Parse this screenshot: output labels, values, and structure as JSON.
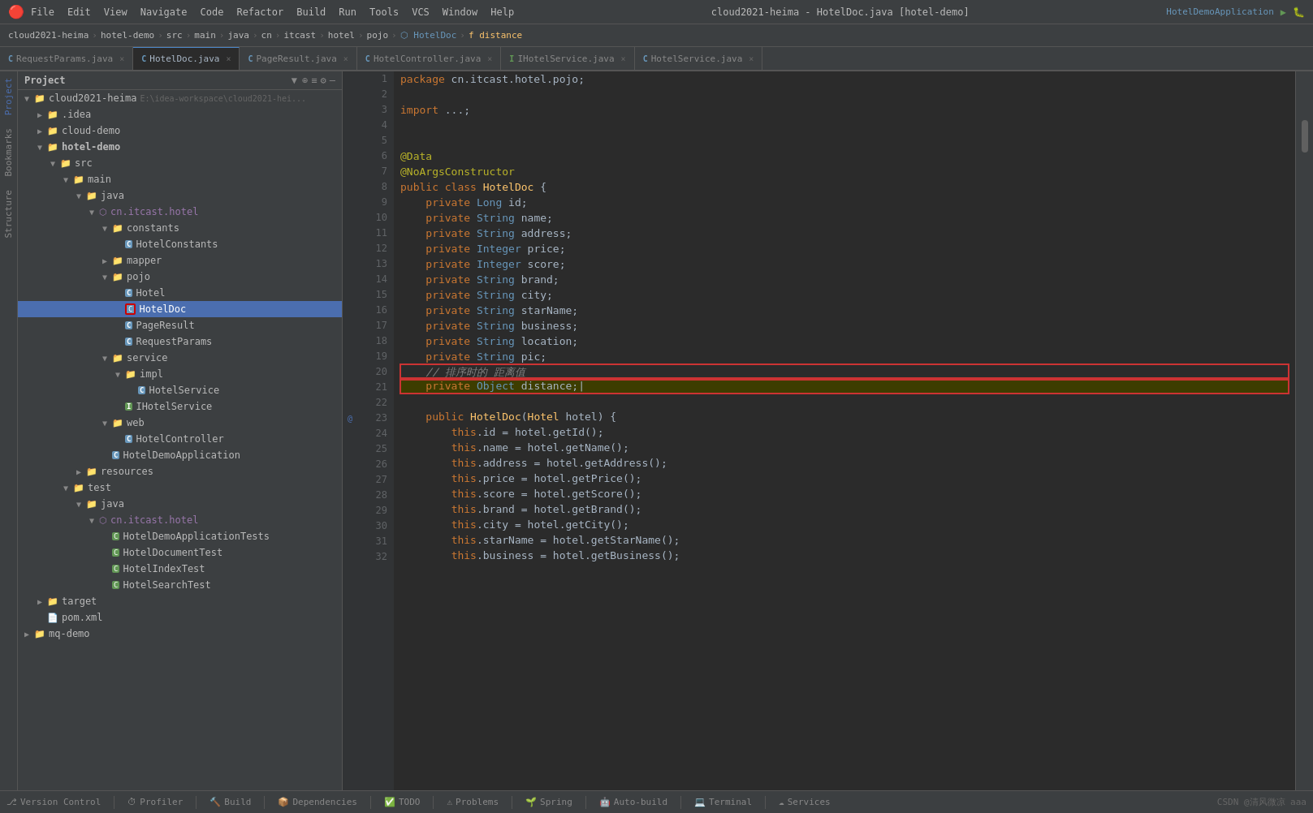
{
  "titleBar": {
    "logo": "🔴",
    "menus": [
      "File",
      "Edit",
      "View",
      "Navigate",
      "Code",
      "Refactor",
      "Build",
      "Run",
      "Tools",
      "VCS",
      "Window",
      "Help"
    ],
    "title": "cloud2021-heima - HotelDoc.java [hotel-demo]",
    "runConfig": "HotelDemoApplication"
  },
  "breadcrumb": {
    "items": [
      "cloud2021-heima",
      "hotel-demo",
      "src",
      "main",
      "java",
      "cn",
      "itcast",
      "hotel",
      "pojo",
      "HotelDoc",
      "distance"
    ]
  },
  "tabs": [
    {
      "label": "RequestParams.java",
      "type": "c",
      "active": false,
      "closable": true
    },
    {
      "label": "HotelDoc.java",
      "type": "c",
      "active": true,
      "closable": true
    },
    {
      "label": "PageResult.java",
      "type": "c",
      "active": false,
      "closable": true
    },
    {
      "label": "HotelController.java",
      "type": "c",
      "active": false,
      "closable": true
    },
    {
      "label": "IHotelService.java",
      "type": "i",
      "active": false,
      "closable": true
    },
    {
      "label": "HotelService.java",
      "type": "c",
      "active": false,
      "closable": true
    }
  ],
  "sidebar": {
    "title": "Project",
    "tree": [
      {
        "indent": 0,
        "arrow": "▼",
        "icon": "folder",
        "label": "cloud2021-heima",
        "extra": "E:\\idea-workspace\\cloud2021-hei..."
      },
      {
        "indent": 1,
        "arrow": "▶",
        "icon": "folder",
        "label": ".idea"
      },
      {
        "indent": 1,
        "arrow": "▶",
        "icon": "folder",
        "label": "cloud-demo"
      },
      {
        "indent": 1,
        "arrow": "▼",
        "icon": "folder",
        "label": "hotel-demo",
        "bold": true
      },
      {
        "indent": 2,
        "arrow": "▼",
        "icon": "folder",
        "label": "src"
      },
      {
        "indent": 3,
        "arrow": "▼",
        "icon": "folder",
        "label": "main"
      },
      {
        "indent": 4,
        "arrow": "▼",
        "icon": "folder",
        "label": "java"
      },
      {
        "indent": 5,
        "arrow": "▼",
        "icon": "package",
        "label": "cn.itcast.hotel"
      },
      {
        "indent": 6,
        "arrow": "▼",
        "icon": "folder",
        "label": "constants"
      },
      {
        "indent": 7,
        "arrow": "",
        "icon": "c",
        "label": "HotelConstants"
      },
      {
        "indent": 6,
        "arrow": "▶",
        "icon": "folder",
        "label": "mapper"
      },
      {
        "indent": 6,
        "arrow": "▼",
        "icon": "folder",
        "label": "pojo"
      },
      {
        "indent": 7,
        "arrow": "",
        "icon": "c",
        "label": "Hotel"
      },
      {
        "indent": 7,
        "arrow": "",
        "icon": "c",
        "label": "HotelDoc",
        "selected": true
      },
      {
        "indent": 7,
        "arrow": "",
        "icon": "c",
        "label": "PageResult"
      },
      {
        "indent": 7,
        "arrow": "",
        "icon": "c",
        "label": "RequestParams"
      },
      {
        "indent": 6,
        "arrow": "▼",
        "icon": "folder",
        "label": "service"
      },
      {
        "indent": 7,
        "arrow": "▼",
        "icon": "folder",
        "label": "impl"
      },
      {
        "indent": 8,
        "arrow": "",
        "icon": "c",
        "label": "HotelService"
      },
      {
        "indent": 7,
        "arrow": "",
        "icon": "i",
        "label": "IHotelService"
      },
      {
        "indent": 6,
        "arrow": "▼",
        "icon": "folder",
        "label": "web"
      },
      {
        "indent": 7,
        "arrow": "",
        "icon": "c",
        "label": "HotelController"
      },
      {
        "indent": 6,
        "arrow": "",
        "icon": "c",
        "label": "HotelDemoApplication"
      },
      {
        "indent": 5,
        "arrow": "▶",
        "icon": "folder",
        "label": "resources"
      },
      {
        "indent": 3,
        "arrow": "▼",
        "icon": "folder",
        "label": "test"
      },
      {
        "indent": 4,
        "arrow": "▼",
        "icon": "folder",
        "label": "java"
      },
      {
        "indent": 5,
        "arrow": "▼",
        "icon": "package",
        "label": "cn.itcast.hotel"
      },
      {
        "indent": 6,
        "arrow": "",
        "icon": "ct",
        "label": "HotelDemoApplicationTests"
      },
      {
        "indent": 6,
        "arrow": "",
        "icon": "ct",
        "label": "HotelDocumentTest"
      },
      {
        "indent": 6,
        "arrow": "",
        "icon": "ct",
        "label": "HotelIndexTest"
      },
      {
        "indent": 6,
        "arrow": "",
        "icon": "ct",
        "label": "HotelSearchTest"
      },
      {
        "indent": 1,
        "arrow": "▶",
        "icon": "folder",
        "label": "target"
      },
      {
        "indent": 1,
        "arrow": "",
        "icon": "xml",
        "label": "pom.xml"
      },
      {
        "indent": 0,
        "arrow": "▶",
        "icon": "folder",
        "label": "mq-demo"
      }
    ]
  },
  "code": {
    "lines": [
      {
        "num": 1,
        "content": "package cn.itcast.hotel.pojo;",
        "tokens": [
          {
            "t": "kw",
            "v": "package"
          },
          {
            "t": "plain",
            "v": " cn.itcast.hotel.pojo;"
          }
        ]
      },
      {
        "num": 2,
        "content": "",
        "tokens": []
      },
      {
        "num": 3,
        "content": "import ...;",
        "tokens": [
          {
            "t": "kw",
            "v": "import"
          },
          {
            "t": "plain",
            "v": " ...;"
          }
        ]
      },
      {
        "num": 4,
        "content": "",
        "tokens": []
      },
      {
        "num": 5,
        "content": "",
        "tokens": []
      },
      {
        "num": 6,
        "content": "@Data",
        "tokens": [
          {
            "t": "annotation",
            "v": "@Data"
          }
        ]
      },
      {
        "num": 7,
        "content": "@NoArgsConstructor",
        "tokens": [
          {
            "t": "annotation",
            "v": "@NoArgsConstructor"
          }
        ]
      },
      {
        "num": 8,
        "content": "public class HotelDoc {",
        "tokens": [
          {
            "t": "kw",
            "v": "public"
          },
          {
            "t": "plain",
            "v": " "
          },
          {
            "t": "kw",
            "v": "class"
          },
          {
            "t": "plain",
            "v": " "
          },
          {
            "t": "cls",
            "v": "HotelDoc"
          },
          {
            "t": "plain",
            "v": " {"
          }
        ]
      },
      {
        "num": 9,
        "content": "    private Long id;",
        "tokens": [
          {
            "t": "plain",
            "v": "    "
          },
          {
            "t": "kw",
            "v": "private"
          },
          {
            "t": "plain",
            "v": " "
          },
          {
            "t": "type",
            "v": "Long"
          },
          {
            "t": "plain",
            "v": " id;"
          }
        ]
      },
      {
        "num": 10,
        "content": "    private String name;",
        "tokens": [
          {
            "t": "plain",
            "v": "    "
          },
          {
            "t": "kw",
            "v": "private"
          },
          {
            "t": "plain",
            "v": " "
          },
          {
            "t": "type",
            "v": "String"
          },
          {
            "t": "plain",
            "v": " name;"
          }
        ]
      },
      {
        "num": 11,
        "content": "    private String address;",
        "tokens": [
          {
            "t": "plain",
            "v": "    "
          },
          {
            "t": "kw",
            "v": "private"
          },
          {
            "t": "plain",
            "v": " "
          },
          {
            "t": "type",
            "v": "String"
          },
          {
            "t": "plain",
            "v": " address;"
          }
        ]
      },
      {
        "num": 12,
        "content": "    private Integer price;",
        "tokens": [
          {
            "t": "plain",
            "v": "    "
          },
          {
            "t": "kw",
            "v": "private"
          },
          {
            "t": "plain",
            "v": " "
          },
          {
            "t": "type",
            "v": "Integer"
          },
          {
            "t": "plain",
            "v": " price;"
          }
        ]
      },
      {
        "num": 13,
        "content": "    private Integer score;",
        "tokens": [
          {
            "t": "plain",
            "v": "    "
          },
          {
            "t": "kw",
            "v": "private"
          },
          {
            "t": "plain",
            "v": " "
          },
          {
            "t": "type",
            "v": "Integer"
          },
          {
            "t": "plain",
            "v": " score;"
          }
        ]
      },
      {
        "num": 14,
        "content": "    private String brand;",
        "tokens": [
          {
            "t": "plain",
            "v": "    "
          },
          {
            "t": "kw",
            "v": "private"
          },
          {
            "t": "plain",
            "v": " "
          },
          {
            "t": "type",
            "v": "String"
          },
          {
            "t": "plain",
            "v": " brand;"
          }
        ]
      },
      {
        "num": 15,
        "content": "    private String city;",
        "tokens": [
          {
            "t": "plain",
            "v": "    "
          },
          {
            "t": "kw",
            "v": "private"
          },
          {
            "t": "plain",
            "v": " "
          },
          {
            "t": "type",
            "v": "String"
          },
          {
            "t": "plain",
            "v": " city;"
          }
        ]
      },
      {
        "num": 16,
        "content": "    private String starName;",
        "tokens": [
          {
            "t": "plain",
            "v": "    "
          },
          {
            "t": "kw",
            "v": "private"
          },
          {
            "t": "plain",
            "v": " "
          },
          {
            "t": "type",
            "v": "String"
          },
          {
            "t": "plain",
            "v": " starName;"
          }
        ]
      },
      {
        "num": 17,
        "content": "    private String business;",
        "tokens": [
          {
            "t": "plain",
            "v": "    "
          },
          {
            "t": "kw",
            "v": "private"
          },
          {
            "t": "plain",
            "v": " "
          },
          {
            "t": "type",
            "v": "String"
          },
          {
            "t": "plain",
            "v": " business;"
          }
        ]
      },
      {
        "num": 18,
        "content": "    private String location;",
        "tokens": [
          {
            "t": "plain",
            "v": "    "
          },
          {
            "t": "kw",
            "v": "private"
          },
          {
            "t": "plain",
            "v": " "
          },
          {
            "t": "type",
            "v": "String"
          },
          {
            "t": "plain",
            "v": " location;"
          }
        ]
      },
      {
        "num": 19,
        "content": "    private String pic;",
        "tokens": [
          {
            "t": "plain",
            "v": "    "
          },
          {
            "t": "kw",
            "v": "private"
          },
          {
            "t": "plain",
            "v": " "
          },
          {
            "t": "type",
            "v": "String"
          },
          {
            "t": "plain",
            "v": " pic;"
          }
        ]
      },
      {
        "num": 20,
        "content": "    // 排序时的 距离值",
        "tokens": [
          {
            "t": "comment",
            "v": "    // 排序时的 距离值"
          }
        ],
        "boxed": true
      },
      {
        "num": 21,
        "content": "    private Object distance;",
        "tokens": [
          {
            "t": "plain",
            "v": "    "
          },
          {
            "t": "kw",
            "v": "private"
          },
          {
            "t": "plain",
            "v": " "
          },
          {
            "t": "type",
            "v": "Object"
          },
          {
            "t": "plain",
            "v": " distance;"
          }
        ],
        "boxed": true,
        "highlighted": true
      },
      {
        "num": 22,
        "content": "",
        "tokens": []
      },
      {
        "num": 23,
        "content": "    public HotelDoc(Hotel hotel) {",
        "tokens": [
          {
            "t": "plain",
            "v": "    "
          },
          {
            "t": "kw",
            "v": "public"
          },
          {
            "t": "plain",
            "v": " "
          },
          {
            "t": "cls",
            "v": "HotelDoc"
          },
          {
            "t": "plain",
            "v": "("
          },
          {
            "t": "cls",
            "v": "Hotel"
          },
          {
            "t": "plain",
            "v": " hotel) {"
          }
        ],
        "annotation": "@"
      },
      {
        "num": 24,
        "content": "        this.id = hotel.getId();",
        "tokens": [
          {
            "t": "plain",
            "v": "        "
          },
          {
            "t": "kw",
            "v": "this"
          },
          {
            "t": "plain",
            "v": ".id = hotel.getId();"
          }
        ]
      },
      {
        "num": 25,
        "content": "        this.name = hotel.getName();",
        "tokens": [
          {
            "t": "plain",
            "v": "        "
          },
          {
            "t": "kw",
            "v": "this"
          },
          {
            "t": "plain",
            "v": ".name = hotel.getName();"
          }
        ]
      },
      {
        "num": 26,
        "content": "        this.address = hotel.getAddress();",
        "tokens": [
          {
            "t": "plain",
            "v": "        "
          },
          {
            "t": "kw",
            "v": "this"
          },
          {
            "t": "plain",
            "v": ".address = hotel.getAddress();"
          }
        ]
      },
      {
        "num": 27,
        "content": "        this.price = hotel.getPrice();",
        "tokens": [
          {
            "t": "plain",
            "v": "        "
          },
          {
            "t": "kw",
            "v": "this"
          },
          {
            "t": "plain",
            "v": ".price = hotel.getPrice();"
          }
        ]
      },
      {
        "num": 28,
        "content": "        this.score = hotel.getScore();",
        "tokens": [
          {
            "t": "plain",
            "v": "        "
          },
          {
            "t": "kw",
            "v": "this"
          },
          {
            "t": "plain",
            "v": ".score = hotel.getScore();"
          }
        ]
      },
      {
        "num": 29,
        "content": "        this.brand = hotel.getBrand();",
        "tokens": [
          {
            "t": "plain",
            "v": "        "
          },
          {
            "t": "kw",
            "v": "this"
          },
          {
            "t": "plain",
            "v": ".brand = hotel.getBrand();"
          }
        ]
      },
      {
        "num": 30,
        "content": "        this.city = hotel.getCity();",
        "tokens": [
          {
            "t": "plain",
            "v": "        "
          },
          {
            "t": "kw",
            "v": "this"
          },
          {
            "t": "plain",
            "v": ".city = hotel.getCity();"
          }
        ]
      },
      {
        "num": 31,
        "content": "        this.starName = hotel.getStarName();",
        "tokens": [
          {
            "t": "plain",
            "v": "        "
          },
          {
            "t": "kw",
            "v": "this"
          },
          {
            "t": "plain",
            "v": ".starName = hotel.getStarName();"
          }
        ]
      },
      {
        "num": 32,
        "content": "        this.business = hotel.getBusiness();",
        "tokens": [
          {
            "t": "plain",
            "v": "        "
          },
          {
            "t": "kw",
            "v": "this"
          },
          {
            "t": "plain",
            "v": ".business = hotel.getBusiness();"
          }
        ]
      }
    ]
  },
  "statusBar": {
    "items": [
      {
        "icon": "⎇",
        "label": "Version Control"
      },
      {
        "icon": "⏱",
        "label": "Profiler"
      },
      {
        "icon": "🔨",
        "label": "Build"
      },
      {
        "icon": "📦",
        "label": "Dependencies"
      },
      {
        "icon": "✅",
        "label": "TODO"
      },
      {
        "icon": "⚠",
        "label": "Problems"
      },
      {
        "icon": "🌱",
        "label": "Spring"
      },
      {
        "icon": "🤖",
        "label": "Auto-build"
      },
      {
        "icon": "💻",
        "label": "Terminal"
      },
      {
        "icon": "☁",
        "label": "Services"
      }
    ],
    "right": "CSDN @清风微凉 aaa"
  }
}
